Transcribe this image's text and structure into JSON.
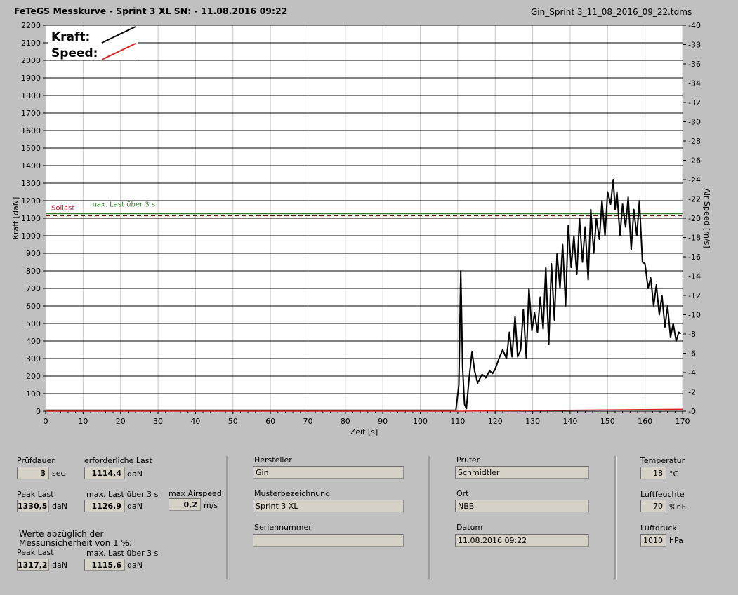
{
  "header": {
    "title": "FeTeGS Messkurve - Sprint 3 XL  SN:  - 11.08.2016 09:22",
    "filename": "Gin_Sprint 3_11_08_2016_09_22.tdms"
  },
  "chart_data": {
    "type": "line",
    "xlabel": "Zeit [s]",
    "ylabel": "Kraft [daN]",
    "y2label": "Air Speed [m/s]",
    "xlim": [
      0,
      170
    ],
    "ylim": [
      0,
      2200
    ],
    "y2lim": [
      0,
      40
    ],
    "xticks": [
      0,
      10,
      20,
      30,
      40,
      50,
      60,
      70,
      80,
      90,
      100,
      110,
      120,
      130,
      140,
      150,
      160,
      170
    ],
    "yticks": [
      0,
      100,
      200,
      300,
      400,
      500,
      600,
      700,
      800,
      900,
      1000,
      1100,
      1200,
      1300,
      1400,
      1500,
      1600,
      1700,
      1800,
      1900,
      2000,
      2100,
      2200
    ],
    "y2ticks": [
      0,
      2,
      4,
      6,
      8,
      10,
      12,
      14,
      16,
      18,
      20,
      22,
      24,
      26,
      28,
      30,
      32,
      34,
      36,
      38,
      40
    ],
    "grid": true,
    "legend": {
      "placement": "top-left",
      "entries": [
        {
          "label": "Kraft:",
          "color": "#000000"
        },
        {
          "label": "Speed:",
          "color": "#e02020"
        }
      ]
    },
    "reference_lines": [
      {
        "label": "Sollast",
        "value": 1114.4,
        "color": "#c02030",
        "style": "dashed"
      },
      {
        "label": "max. Last über  3 s",
        "value": 1126.9,
        "color": "#2e7d2e",
        "style": "solid"
      }
    ],
    "series": [
      {
        "name": "Kraft",
        "axis": "left",
        "color": "#000000",
        "x": [
          0,
          20,
          40,
          60,
          80,
          100,
          109.5,
          110.3,
          110.8,
          111.3,
          111.8,
          112.3,
          113.0,
          113.8,
          114.5,
          115.3,
          116.5,
          117.5,
          118.5,
          119.3,
          120.0,
          121.0,
          122.0,
          123.0,
          123.8,
          124.5,
          125.3,
          126.0,
          126.8,
          127.5,
          128.3,
          129.0,
          129.8,
          130.5,
          131.3,
          132.0,
          132.8,
          133.5,
          134.3,
          135.0,
          135.8,
          136.5,
          137.3,
          138.0,
          138.8,
          139.5,
          140.3,
          141.0,
          141.8,
          142.5,
          143.3,
          144.0,
          144.8,
          145.5,
          146.3,
          147.0,
          147.8,
          148.5,
          149.3,
          150.0,
          150.8,
          151.5,
          152.0,
          152.5,
          153.3,
          154.0,
          154.8,
          155.5,
          156.3,
          157.0,
          157.8,
          158.5,
          159.3,
          160.0,
          160.8,
          161.5,
          162.3,
          163.0,
          163.8,
          164.5,
          165.3,
          166.0,
          166.8,
          167.5,
          168.3,
          169.0,
          169.5
        ],
        "values": [
          5,
          5,
          5,
          5,
          5,
          5,
          5,
          150,
          800,
          250,
          40,
          15,
          180,
          340,
          230,
          160,
          210,
          190,
          230,
          215,
          240,
          300,
          350,
          300,
          450,
          310,
          540,
          310,
          350,
          580,
          300,
          700,
          460,
          560,
          450,
          650,
          470,
          820,
          380,
          840,
          520,
          900,
          700,
          950,
          600,
          1060,
          820,
          1000,
          780,
          1100,
          850,
          1050,
          750,
          1150,
          900,
          1100,
          980,
          1200,
          1000,
          1250,
          1180,
          1320,
          1150,
          1250,
          1000,
          1180,
          1050,
          1220,
          920,
          1150,
          1000,
          1200,
          850,
          840,
          700,
          760,
          600,
          720,
          550,
          660,
          480,
          600,
          420,
          500,
          400,
          450,
          440
        ]
      },
      {
        "name": "Speed",
        "axis": "right",
        "color": "#e02020",
        "x": [
          0,
          110,
          170
        ],
        "values": [
          0,
          0,
          0.2
        ]
      }
    ]
  },
  "info": {
    "pruefdauer": {
      "label": "Prüfdauer",
      "value": "3",
      "unit": "sec"
    },
    "erforderliche_last": {
      "label": "erforderliche Last",
      "value": "1114,4",
      "unit": "daN"
    },
    "peak_last": {
      "label": "Peak Last",
      "value": "1330,5",
      "unit": "daN"
    },
    "max_last": {
      "label": "max. Last über  3 s",
      "value": "1126,9",
      "unit": "daN"
    },
    "max_airspeed": {
      "label": "max Airspeed",
      "value": "0,2",
      "unit": "m/s"
    },
    "werte_note_line1": "Werte abzüglich der",
    "werte_note_line2": "Messunsicherheit von 1  %:",
    "peak_last_corr": {
      "label": "Peak Last",
      "value": "1317,2",
      "unit": "daN"
    },
    "max_last_corr": {
      "label": "max. Last über  3 s",
      "value": "1115,6",
      "unit": "daN"
    },
    "hersteller": {
      "label": "Hersteller",
      "value": "Gin"
    },
    "musterbezeichnung": {
      "label": "Musterbezeichnung",
      "value": "Sprint 3 XL"
    },
    "seriennummer": {
      "label": "Seriennummer",
      "value": ""
    },
    "pruefer": {
      "label": "Prüfer",
      "value": "Schmidtler"
    },
    "ort": {
      "label": "Ort",
      "value": "NBB"
    },
    "datum": {
      "label": "Datum",
      "value": "11.08.2016 09:22"
    },
    "temperatur": {
      "label": "Temperatur",
      "value": "18",
      "unit": "°C"
    },
    "luftfeuchte": {
      "label": "Luftfeuchte",
      "value": "70",
      "unit": "%r.F."
    },
    "luftdruck": {
      "label": "Luftdruck",
      "value": "1010",
      "unit": "hPa"
    }
  }
}
